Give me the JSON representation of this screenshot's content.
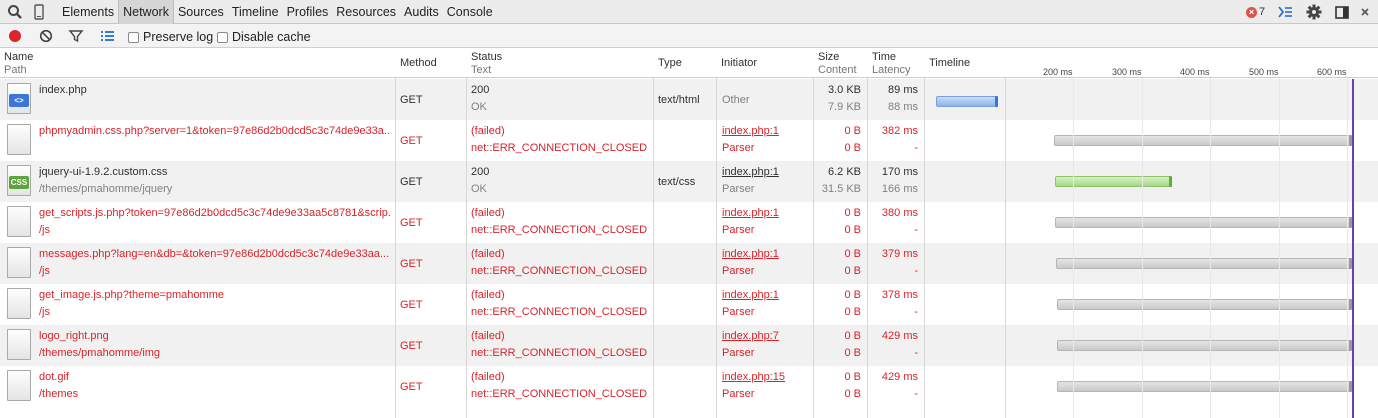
{
  "tabs": [
    "Elements",
    "Network",
    "Sources",
    "Timeline",
    "Profiles",
    "Resources",
    "Audits",
    "Console"
  ],
  "active_tab": "Network",
  "error_count": "7",
  "toolbar": {
    "preserve_log": "Preserve log",
    "disable_cache": "Disable cache"
  },
  "columns": {
    "name": "Name",
    "path": "Path",
    "method": "Method",
    "status": "Status",
    "text": "Text",
    "type": "Type",
    "initiator": "Initiator",
    "size": "Size",
    "content": "Content",
    "time": "Time",
    "latency": "Latency",
    "timeline": "Timeline"
  },
  "timeline_ticks": [
    "200 ms",
    "300 ms",
    "400 ms",
    "500 ms",
    "600 ms"
  ],
  "requests": [
    {
      "name": "index.php",
      "path": "",
      "method": "GET",
      "status": "200",
      "status_text": "OK",
      "type": "text/html",
      "initiator": "Other",
      "initiator_sub": "",
      "size": "3.0 KB",
      "content": "7.9 KB",
      "time": "89 ms",
      "latency": "88 ms",
      "failed": false,
      "icon": "html",
      "bar": "blue"
    },
    {
      "name": "phpmyadmin.css.php?server=1&token=97e86d2b0dcd5c3c74de9e33a...",
      "path": "",
      "method": "GET",
      "status": "(failed)",
      "status_text": "net::ERR_CONNECTION_CLOSED",
      "type": "",
      "initiator": "index.php:1",
      "initiator_sub": "Parser",
      "size": "0 B",
      "content": "0 B",
      "time": "382 ms",
      "latency": "-",
      "failed": true,
      "icon": "blank",
      "bar": "grey"
    },
    {
      "name": "jquery-ui-1.9.2.custom.css",
      "path": "/themes/pmahomme/jquery",
      "method": "GET",
      "status": "200",
      "status_text": "OK",
      "type": "text/css",
      "initiator": "index.php:1",
      "initiator_sub": "Parser",
      "size": "6.2 KB",
      "content": "31.5 KB",
      "time": "170 ms",
      "latency": "166 ms",
      "failed": false,
      "icon": "css",
      "bar": "green"
    },
    {
      "name": "get_scripts.js.php?token=97e86d2b0dcd5c3c74de9e33aa5c8781&scrip...",
      "path": "/js",
      "method": "GET",
      "status": "(failed)",
      "status_text": "net::ERR_CONNECTION_CLOSED",
      "type": "",
      "initiator": "index.php:1",
      "initiator_sub": "Parser",
      "size": "0 B",
      "content": "0 B",
      "time": "380 ms",
      "latency": "-",
      "failed": true,
      "icon": "blank",
      "bar": "grey"
    },
    {
      "name": "messages.php?lang=en&db=&token=97e86d2b0dcd5c3c74de9e33aa...",
      "path": "/js",
      "method": "GET",
      "status": "(failed)",
      "status_text": "net::ERR_CONNECTION_CLOSED",
      "type": "",
      "initiator": "index.php:1",
      "initiator_sub": "Parser",
      "size": "0 B",
      "content": "0 B",
      "time": "379 ms",
      "latency": "-",
      "failed": true,
      "icon": "blank",
      "bar": "grey"
    },
    {
      "name": "get_image.js.php?theme=pmahomme",
      "path": "/js",
      "method": "GET",
      "status": "(failed)",
      "status_text": "net::ERR_CONNECTION_CLOSED",
      "type": "",
      "initiator": "index.php:1",
      "initiator_sub": "Parser",
      "size": "0 B",
      "content": "0 B",
      "time": "378 ms",
      "latency": "-",
      "failed": true,
      "icon": "blank",
      "bar": "grey"
    },
    {
      "name": "logo_right.png",
      "path": "/themes/pmahomme/img",
      "method": "GET",
      "status": "(failed)",
      "status_text": "net::ERR_CONNECTION_CLOSED",
      "type": "",
      "initiator": "index.php:7",
      "initiator_sub": "Parser",
      "size": "0 B",
      "content": "0 B",
      "time": "429 ms",
      "latency": "-",
      "failed": true,
      "icon": "blank",
      "bar": "grey"
    },
    {
      "name": "dot.gif",
      "path": "/themes",
      "method": "GET",
      "status": "(failed)",
      "status_text": "net::ERR_CONNECTION_CLOSED",
      "type": "",
      "initiator": "index.php:15",
      "initiator_sub": "Parser",
      "size": "0 B",
      "content": "0 B",
      "time": "429 ms",
      "latency": "-",
      "failed": true,
      "icon": "blank",
      "bar": "grey"
    }
  ]
}
